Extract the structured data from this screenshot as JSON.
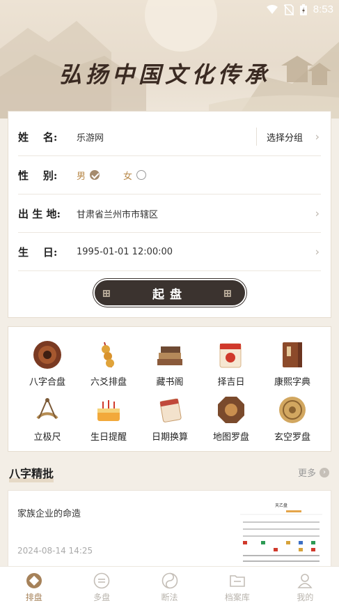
{
  "status_bar": {
    "time": "8:53"
  },
  "banner": {
    "slogan": "弘扬中国文化传承"
  },
  "form": {
    "name_label": "姓    名:",
    "name_value": "乐游网",
    "group_button": "选择分组",
    "gender_label": "性    别:",
    "gender_male": "男",
    "gender_female": "女",
    "gender_selected": "男",
    "birthplace_label": "出 生 地:",
    "birthplace_value": "甘肃省兰州市市辖区",
    "birthday_label": "生    日:",
    "birthday_value": "1995-01-01 12:00:00",
    "submit_label": "起盘"
  },
  "tools": [
    {
      "label": "八字合盘",
      "icon": "compass-plate-icon"
    },
    {
      "label": "六爻排盘",
      "icon": "coins-string-icon"
    },
    {
      "label": "藏书阁",
      "icon": "books-icon"
    },
    {
      "label": "择吉日",
      "icon": "calendar-icon"
    },
    {
      "label": "康熙字典",
      "icon": "dictionary-icon"
    },
    {
      "label": "立极尺",
      "icon": "sextant-icon"
    },
    {
      "label": "生日提醒",
      "icon": "cake-icon"
    },
    {
      "label": "日期换算",
      "icon": "calendar-pages-icon"
    },
    {
      "label": "地图罗盘",
      "icon": "bagua-icon"
    },
    {
      "label": "玄空罗盘",
      "icon": "luopan-icon"
    }
  ],
  "section": {
    "title": "八字精批",
    "more": "更多"
  },
  "article": {
    "title": "家族企业的命造",
    "date": "2024-08-14 14:25",
    "thumb_title": "天乙盘"
  },
  "tabs": [
    {
      "label": "排盘",
      "active": true,
      "icon": "paipan-icon"
    },
    {
      "label": "多盘",
      "active": false,
      "icon": "duopan-icon"
    },
    {
      "label": "断法",
      "active": false,
      "icon": "yinyang-icon"
    },
    {
      "label": "档案库",
      "active": false,
      "icon": "folder-icon"
    },
    {
      "label": "我的",
      "active": false,
      "icon": "user-icon"
    }
  ],
  "colors": {
    "accent": "#a6825a",
    "button": "#3b332f"
  }
}
